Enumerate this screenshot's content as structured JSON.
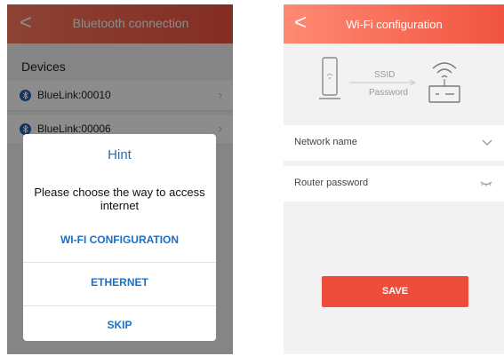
{
  "left": {
    "header_title": "Bluetooth connection",
    "back_glyph": "<",
    "section_label": "Devices",
    "devices": [
      {
        "name": "BlueLink:00010",
        "icon": "bluetooth-icon"
      },
      {
        "name": "BlueLink:00006",
        "icon": "bluetooth-icon"
      }
    ],
    "dialog": {
      "title": "Hint",
      "message": "Please choose the way to access internet",
      "options": [
        "WI-FI CONFIGURATION",
        "ETHERNET",
        "SKIP"
      ]
    }
  },
  "right": {
    "header_title": "Wi-Fi configuration",
    "back_glyph": "<",
    "illustration": {
      "ssid_label": "SSID",
      "password_label": "Password"
    },
    "network_name_label": "Network name",
    "router_password_label": "Router password",
    "save_label": "SAVE"
  },
  "colors": {
    "header_accent": "#f0533f",
    "dialog_link": "#1c6fc4",
    "save_button": "#ee4d3b",
    "bluetooth_badge": "#1f5fb0"
  }
}
